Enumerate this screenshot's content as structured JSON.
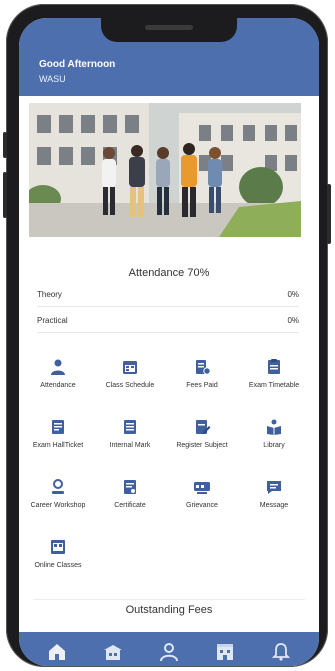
{
  "header": {
    "greeting": "Good Afternoon",
    "user_name": "WASU"
  },
  "attendance": {
    "title": "Attendance 70%",
    "rows": [
      {
        "label": "Theory",
        "value": "0%"
      },
      {
        "label": "Practical",
        "value": "0%"
      }
    ]
  },
  "menu": [
    {
      "label": "Attendance",
      "icon": "person-icon"
    },
    {
      "label": "Class Schedule",
      "icon": "schedule-icon"
    },
    {
      "label": "Fees Paid",
      "icon": "fees-icon"
    },
    {
      "label": "Exam Timetable",
      "icon": "exam-timetable-icon"
    },
    {
      "label": "Exam HallTicket",
      "icon": "hallticket-icon"
    },
    {
      "label": "Internal Mark",
      "icon": "marks-icon"
    },
    {
      "label": "Register Subject",
      "icon": "register-icon"
    },
    {
      "label": "Library",
      "icon": "library-icon"
    },
    {
      "label": "Career Workshop",
      "icon": "career-icon"
    },
    {
      "label": "Certificate",
      "icon": "certificate-icon"
    },
    {
      "label": "Grievance",
      "icon": "grievance-icon"
    },
    {
      "label": "Message",
      "icon": "message-icon"
    },
    {
      "label": "Online Classes",
      "icon": "online-classes-icon"
    }
  ],
  "outstanding": {
    "title": "Outstanding Fees"
  },
  "bottom_nav": [
    {
      "icon": "home-icon"
    },
    {
      "icon": "school-icon"
    },
    {
      "icon": "profile-icon"
    },
    {
      "icon": "building-icon"
    },
    {
      "icon": "bell-icon"
    }
  ],
  "colors": {
    "primary": "#4e6fae",
    "icon": "#3f5f9e",
    "text": "#333333"
  }
}
